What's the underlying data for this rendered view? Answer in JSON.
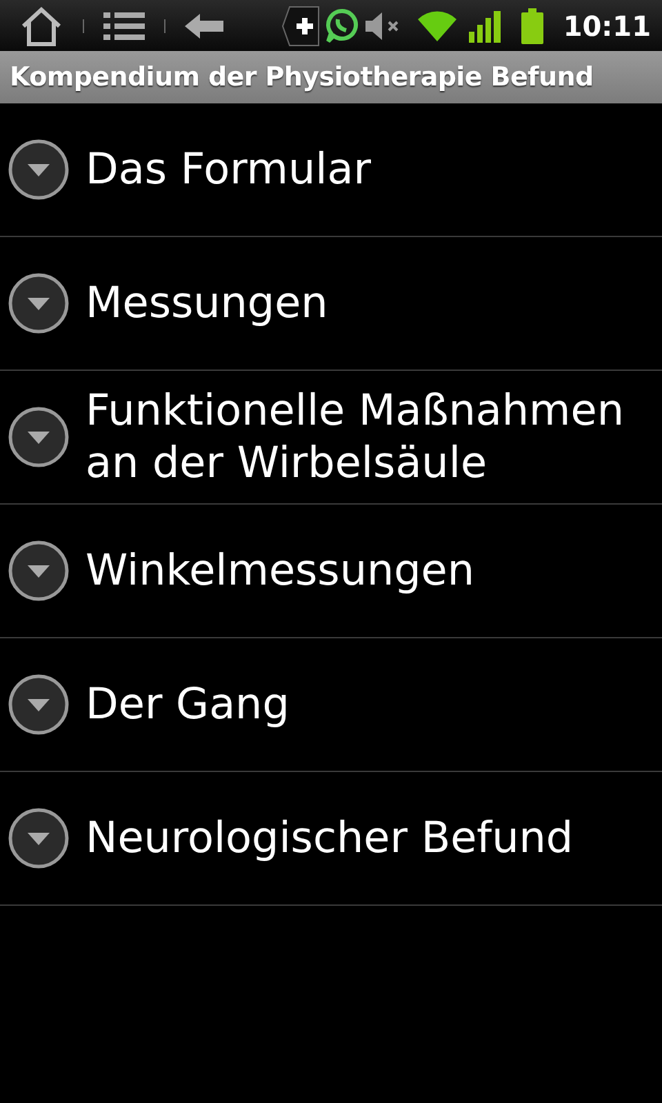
{
  "status_bar": {
    "time": "10:11"
  },
  "title_bar": {
    "title": "Kompendium der Physiotherapie Befund"
  },
  "items": [
    {
      "label": "Das Formular",
      "expanded": false
    },
    {
      "label": "Messungen",
      "expanded": false
    },
    {
      "label": "Funktionelle Maßnahmen an der Wirbelsäule",
      "expanded": false
    },
    {
      "label": "Winkelmessungen",
      "expanded": false
    },
    {
      "label": "Der Gang",
      "expanded": false
    },
    {
      "label": "Neurologischer Befund",
      "expanded": false
    }
  ]
}
